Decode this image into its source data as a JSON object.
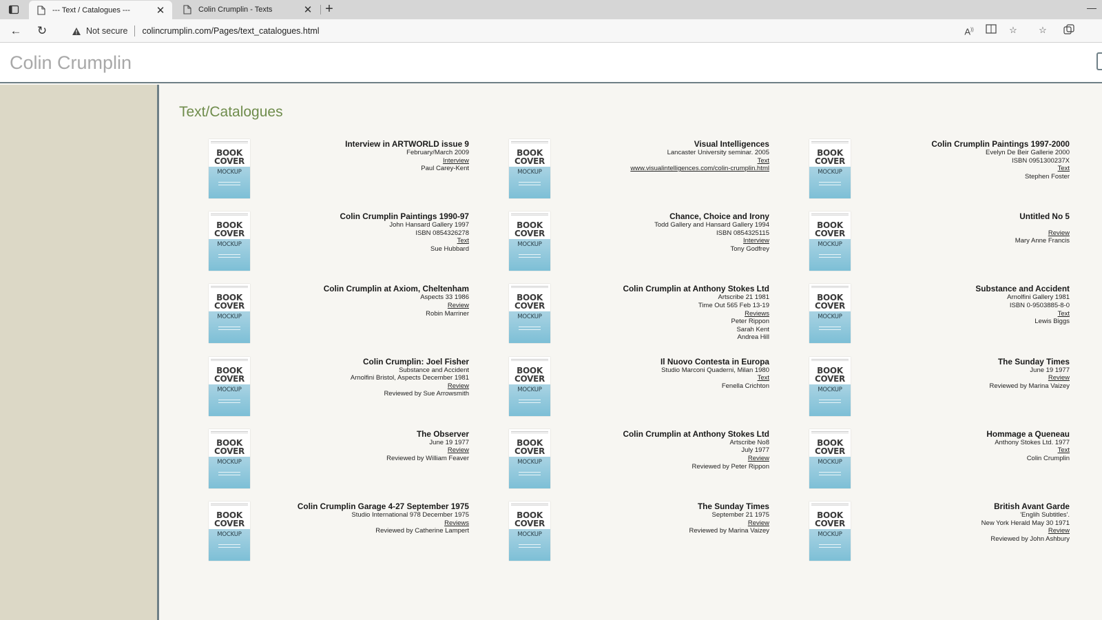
{
  "browser": {
    "tabs": [
      {
        "title": "--- Text / Catalogues ---",
        "active": true
      },
      {
        "title": "Colin Crumplin - Texts",
        "active": false
      }
    ],
    "new_tab": "+",
    "not_secure": "Not secure",
    "url": "colincrumplin.com/Pages/text_catalogues.html"
  },
  "site": {
    "title": "Colin Crumplin",
    "heading": "Text/Catalogues"
  },
  "book_cover": {
    "line1": "BOOK",
    "line2": "COVER",
    "line3": "MOCKUP"
  },
  "columns": [
    [
      {
        "title": "Interview in ARTWORLD issue 9",
        "lines": [
          {
            "text": "February/March 2009"
          },
          {
            "text": "Interview",
            "link": true
          },
          {
            "text": "Paul Carey-Kent"
          }
        ]
      },
      {
        "title": "Colin Crumplin Paintings 1990-97",
        "lines": [
          {
            "text": "John Hansard Gallery 1997"
          },
          {
            "text": "ISBN 0854326278"
          },
          {
            "text": "Text",
            "link": true
          },
          {
            "text": "Sue Hubbard"
          }
        ]
      },
      {
        "title": "Colin Crumplin at Axiom, Cheltenham",
        "lines": [
          {
            "text": "Aspects 33 1986"
          },
          {
            "text": "Review",
            "link": true
          },
          {
            "text": "Robin Marriner"
          }
        ]
      },
      {
        "title": "Colin Crumplin: Joel Fisher",
        "lines": [
          {
            "text": "Substance and Accident"
          },
          {
            "text": "Arnolfini Bristol, Aspects December 1981"
          },
          {
            "text": "Review",
            "link": true
          },
          {
            "text": "Reviewed by Sue Arrowsmith"
          }
        ]
      },
      {
        "title": "The Observer",
        "lines": [
          {
            "text": "June 19 1977"
          },
          {
            "text": "Review",
            "link": true
          },
          {
            "text": "Reviewed by William Feaver"
          }
        ]
      },
      {
        "title": "Colin Crumplin Garage 4-27 September 1975",
        "lines": [
          {
            "text": "Studio International 978 December 1975"
          },
          {
            "text": "Reviews",
            "link": true
          },
          {
            "text": "Reviewed by Catherine Lampert"
          }
        ]
      }
    ],
    [
      {
        "title": "Visual Intelligences",
        "lines": [
          {
            "text": "Lancaster University seminar. 2005"
          },
          {
            "text": "Text",
            "link": true
          },
          {
            "text": "www.visualintelligences.com/colin-crumplin.html",
            "link": true
          }
        ]
      },
      {
        "title": "Chance, Choice and Irony",
        "lines": [
          {
            "text": "Todd Gallery and Hansard Gallery 1994"
          },
          {
            "text": "ISBN 0854325115"
          },
          {
            "text": "Interview",
            "link": true
          },
          {
            "text": "Tony Godfrey"
          }
        ]
      },
      {
        "title": "Colin Crumplin at Anthony Stokes Ltd",
        "lines": [
          {
            "text": "Artscribe 21 1981"
          },
          {
            "text": "Time Out 565 Feb 13-19"
          },
          {
            "text": "Reviews",
            "link": true
          },
          {
            "text": "Peter Rippon"
          },
          {
            "text": "Sarah Kent"
          },
          {
            "text": "Andrea Hill"
          }
        ]
      },
      {
        "title": "Il Nuovo Contesta in Europa",
        "lines": [
          {
            "text": "Studio Marconi Quaderni, Milan 1980"
          },
          {
            "text": "Text",
            "link": true
          },
          {
            "text": "Fenella Crichton"
          }
        ]
      },
      {
        "title": "Colin Crumplin at Anthony Stokes Ltd",
        "lines": [
          {
            "text": "Artscribe No8"
          },
          {
            "text": "July 1977"
          },
          {
            "text": "Review",
            "link": true
          },
          {
            "text": "Reviewed by Peter Rippon"
          }
        ]
      },
      {
        "title": "The Sunday Times",
        "lines": [
          {
            "text": "September 21 1975"
          },
          {
            "text": "Review",
            "link": true
          },
          {
            "text": "Reviewed by Marina Vaizey"
          }
        ]
      }
    ],
    [
      {
        "title": "Colin Crumplin Paintings 1997-2000",
        "lines": [
          {
            "text": "Evelyn De Beir Gallerie 2000"
          },
          {
            "text": "ISBN 0951300237X"
          },
          {
            "text": "Text",
            "link": true
          },
          {
            "text": "Stephen Foster"
          }
        ]
      },
      {
        "title": "Untitled No 5",
        "lines": [
          {
            "text": ""
          },
          {
            "text": "Review",
            "link": true
          },
          {
            "text": "Mary Anne Francis"
          }
        ]
      },
      {
        "title": "Substance and Accident",
        "lines": [
          {
            "text": "Arnolfini Gallery 1981"
          },
          {
            "text": "ISBN 0-9503885-8-0"
          },
          {
            "text": "Text",
            "link": true
          },
          {
            "text": "Lewis Biggs"
          }
        ]
      },
      {
        "title": "The Sunday Times",
        "lines": [
          {
            "text": "June 19 1977"
          },
          {
            "text": "Review",
            "link": true
          },
          {
            "text": "Reviewed by Marina Vaizey"
          }
        ]
      },
      {
        "title": "Hommage a Queneau",
        "lines": [
          {
            "text": "Anthony Stokes Ltd. 1977"
          },
          {
            "text": "Text",
            "link": true
          },
          {
            "text": "Colin Crumplin"
          }
        ]
      },
      {
        "title": "British Avant Garde",
        "lines": [
          {
            "text": "'Englih Subtitles'."
          },
          {
            "text": "New York Herald May 30 1971"
          },
          {
            "text": "Review",
            "link": true
          },
          {
            "text": "Reviewed by John Ashbury"
          }
        ]
      }
    ]
  ]
}
